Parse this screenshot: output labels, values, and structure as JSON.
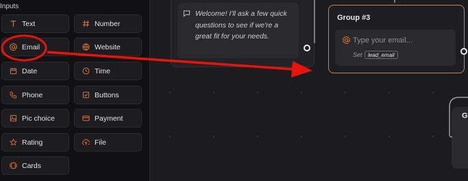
{
  "sidebar": {
    "title": "Inputs",
    "blocks": [
      {
        "label": "Text",
        "icon": "text-icon"
      },
      {
        "label": "Number",
        "icon": "hash-icon"
      },
      {
        "label": "Email",
        "icon": "at-icon"
      },
      {
        "label": "Website",
        "icon": "globe-icon"
      },
      {
        "label": "Date",
        "icon": "calendar-icon"
      },
      {
        "label": "Time",
        "icon": "clock-icon"
      },
      {
        "label": "Phone",
        "icon": "phone-icon"
      },
      {
        "label": "Buttons",
        "icon": "checkbox-icon"
      },
      {
        "label": "Pic choice",
        "icon": "image-icon"
      },
      {
        "label": "Payment",
        "icon": "credit-card-icon"
      },
      {
        "label": "Rating",
        "icon": "star-icon"
      },
      {
        "label": "File",
        "icon": "upload-icon"
      },
      {
        "label": "Cards",
        "icon": "cards-icon"
      }
    ]
  },
  "canvas": {
    "welcome_message": "Welcome! I'll ask a few quick questions to see if we're a great fit for your needs.",
    "group3": {
      "title": "Group #3",
      "email_placeholder": "Type your email...",
      "set_label": "Set",
      "variable": "lead_email"
    },
    "right_group_label": "G"
  },
  "colors": {
    "accent": "#e06c2e",
    "annotation": "#e8140c",
    "selected_border": "#c9834e"
  }
}
